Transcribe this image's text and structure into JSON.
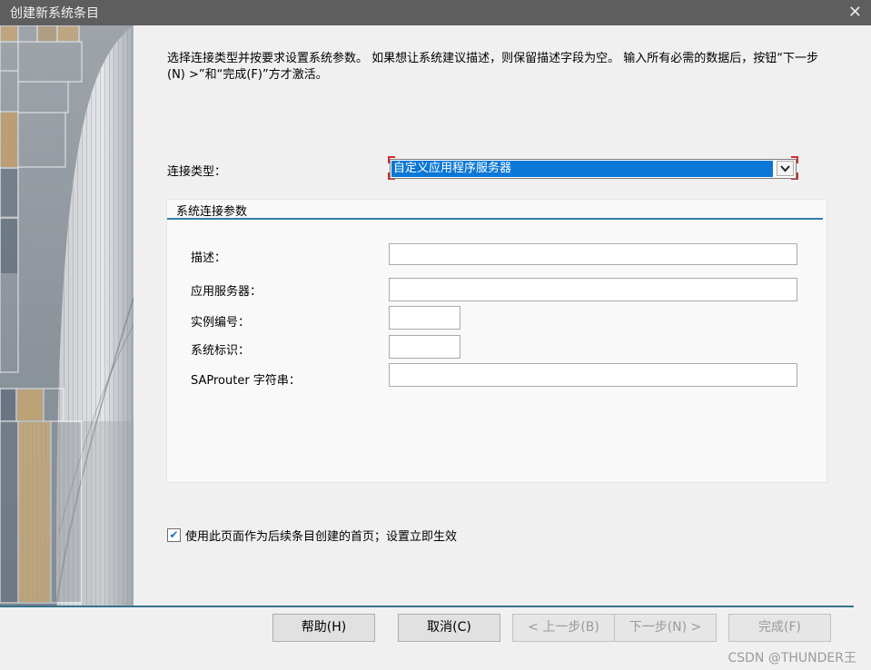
{
  "window": {
    "title": "创建新系统条目",
    "close_glyph": "✕"
  },
  "intro_text": "选择连接类型并按要求设置系统参数。 如果想让系统建议描述，则保留描述字段为空。 输入所有必需的数据后，按钮“下一步(N) >”和“完成(F)”方才激活。",
  "connection": {
    "label": "连接类型：",
    "selected": "自定义应用程序服务器",
    "arrow_glyph": "⌄"
  },
  "group": {
    "title": "系统连接参数",
    "fields": {
      "description_label": "描述：",
      "description_value": "",
      "app_server_label": "应用服务器：",
      "app_server_value": "",
      "instance_label": "实例编号：",
      "instance_value": "",
      "system_id_label": "系统标识：",
      "system_id_value": "",
      "saprouter_label": "SAProuter 字符串：",
      "saprouter_value": ""
    }
  },
  "checkbox": {
    "label": "使用此页面作为后续条目创建的首页；设置立即生效",
    "checked": true,
    "check_glyph": "✔"
  },
  "buttons": {
    "help": "帮助(H)",
    "cancel": "取消(C)",
    "back": "< 上一步(B)",
    "next": "下一步(N) >",
    "finish": "完成(F)"
  },
  "watermark": "CSDN @THUNDER王",
  "colors": {
    "titlebar": "#5e5e5e",
    "selection": "#0b77d6",
    "group_line": "#2f7fab",
    "focus_corner": "#d32f2f"
  }
}
